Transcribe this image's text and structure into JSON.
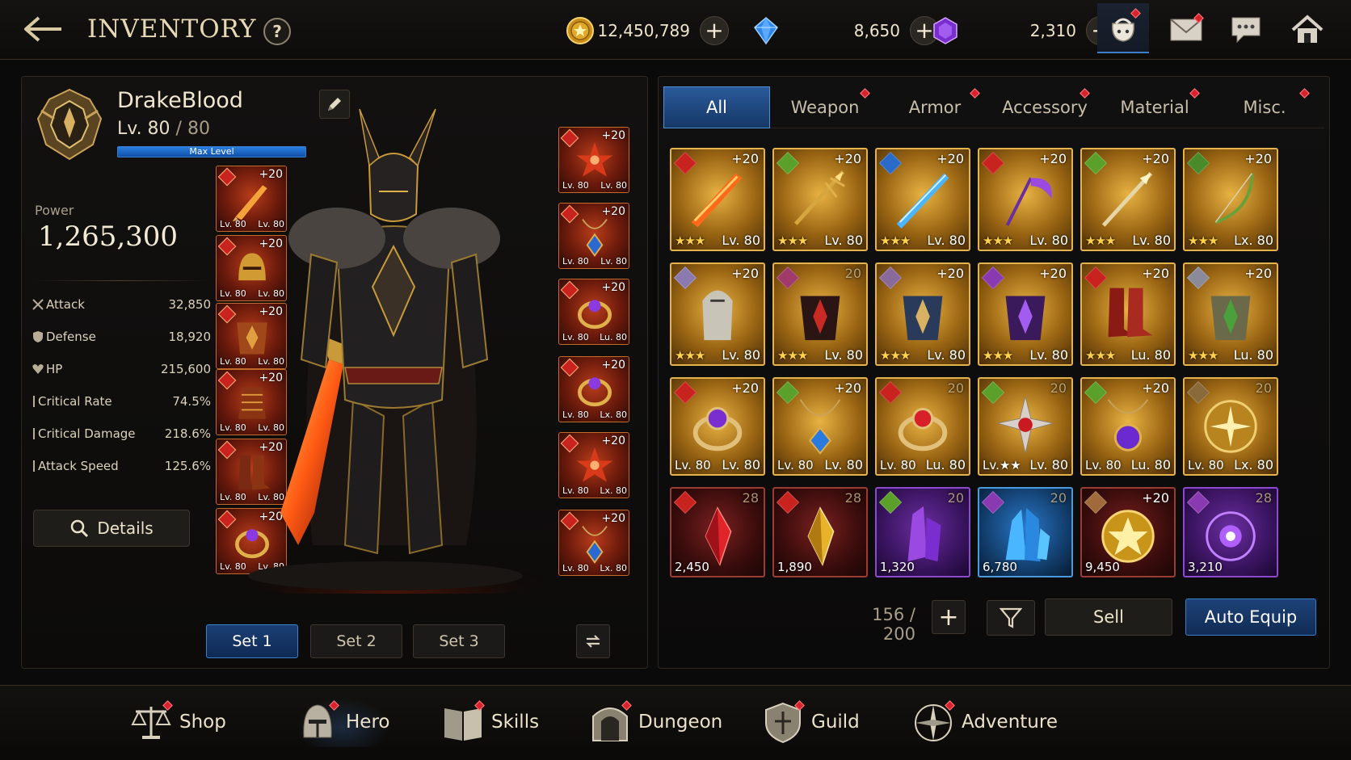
{
  "header": {
    "title": "INVENTORY",
    "help_label": "?",
    "currencies": [
      {
        "name": "gold",
        "value": "12,450,789",
        "icon": "gold-coin-icon",
        "color": "#e0a92a"
      },
      {
        "name": "blue-gem",
        "value": "8,650",
        "icon": "blue-gem-icon",
        "color": "#2f86e8"
      },
      {
        "name": "purple-gem",
        "value": "2,310",
        "icon": "purple-gem-icon",
        "color": "#8a3ee0"
      }
    ],
    "plus_label": "+",
    "icons": [
      "bag-icon",
      "mail-icon",
      "chat-icon",
      "home-icon"
    ]
  },
  "hero": {
    "name": "DrakeBlood",
    "level_prefix": "Lv. 80",
    "level_max": " / 80",
    "max_level_label": "Max Level",
    "power_label": "Power",
    "power_value": "1,265,300",
    "stats": [
      {
        "name": "Attack",
        "value": "32,850",
        "icon": "swords-icon"
      },
      {
        "name": "Defense",
        "value": "18,920",
        "icon": "shield-icon"
      },
      {
        "name": "HP",
        "value": "215,600",
        "icon": "heart-icon"
      },
      {
        "name": "Critical Rate",
        "value": "74.5%",
        "icon": "crit-icon"
      },
      {
        "name": "Critical Damage",
        "value": "218.6%",
        "icon": "crit-icon"
      },
      {
        "name": "Attack Speed",
        "value": "125.6%",
        "icon": "speed-icon"
      }
    ],
    "details_label": "Details",
    "left_slots": [
      {
        "plus": "+20",
        "lv_a": "Lv. 80",
        "lv_b": "Lv. 80",
        "icon": "sword-icon"
      },
      {
        "plus": "+20",
        "lv_a": "Lv. 80",
        "lv_b": "Lv. 80",
        "icon": "helmet-icon"
      },
      {
        "plus": "+20",
        "lv_a": "Lv. 80",
        "lv_b": "Lv. 80",
        "icon": "chest-armor-icon"
      },
      {
        "plus": "+20",
        "lv_a": "Lv. 80",
        "lv_b": "Lv. 80",
        "icon": "gauntlet-icon"
      },
      {
        "plus": "+20",
        "lv_a": "Lv. 80",
        "lv_b": "Lv. 80",
        "icon": "boots-icon"
      },
      {
        "plus": "+20",
        "lv_a": "Lv. 80",
        "lv_b": "Lv. 80",
        "icon": "ring-icon"
      }
    ],
    "right_slots": [
      {
        "plus": "+20",
        "lv_a": "Lv. 80",
        "lv_b": "Lv. 80",
        "icon": "spiked-orb-icon"
      },
      {
        "plus": "+20",
        "lv_a": "Lv. 80",
        "lv_b": "Lv. 80",
        "icon": "amulet-icon"
      },
      {
        "plus": "+20",
        "lv_a": "Lv. 80",
        "lv_b": "Lu. 80",
        "icon": "ring-icon"
      },
      {
        "plus": "+20",
        "lv_a": "Lv. 80",
        "lv_b": "Lx. 80",
        "icon": "ring-icon"
      },
      {
        "plus": "+20",
        "lv_a": "Lv. 80",
        "lv_b": "Lx. 80",
        "icon": "spiked-orb-icon"
      },
      {
        "plus": "+20",
        "lv_a": "Lv. 80",
        "lv_b": "Lx. 80",
        "icon": "amulet-icon"
      }
    ],
    "sets": [
      "Set 1",
      "Set 2",
      "Set 3"
    ],
    "active_set": 0
  },
  "inventory": {
    "tabs": [
      {
        "label": "All",
        "badge": false
      },
      {
        "label": "Weapon",
        "badge": true
      },
      {
        "label": "Armor",
        "badge": true
      },
      {
        "label": "Accessory",
        "badge": true
      },
      {
        "label": "Material",
        "badge": true
      },
      {
        "label": "Misc.",
        "badge": true
      }
    ],
    "active_tab": 0,
    "rows": [
      [
        {
          "frame": "gold",
          "rank_color": "#c9231f",
          "plus": "+20",
          "stars": "★★★",
          "lv": "Lv. 80",
          "icon": "flame-sword-icon"
        },
        {
          "frame": "gold",
          "rank_color": "#5aa02a",
          "plus": "+20",
          "stars": "★★★",
          "lv": "Lv. 80",
          "icon": "golden-spear-icon"
        },
        {
          "frame": "gold",
          "rank_color": "#2a6ac8",
          "plus": "+20",
          "stars": "★★★",
          "lv": "Lv. 80",
          "icon": "ice-sword-icon"
        },
        {
          "frame": "gold",
          "rank_color": "#c9231f",
          "plus": "+20",
          "stars": "★★★",
          "lv": "Lv. 80",
          "icon": "scythe-icon"
        },
        {
          "frame": "gold",
          "rank_color": "#5aa02a",
          "plus": "+20",
          "stars": "★★★",
          "lv": "Lv. 80",
          "icon": "lance-icon"
        },
        {
          "frame": "gold",
          "rank_color": "#4a8a2a",
          "plus": "+20",
          "stars": "★★★",
          "lv": "Lx. 80",
          "icon": "bow-icon"
        }
      ],
      [
        {
          "frame": "gold",
          "rank_color": "#8a7ab0",
          "plus": "+20",
          "stars": "★★★",
          "lv": "Lv. 80",
          "icon": "silver-armor-icon"
        },
        {
          "frame": "gold",
          "rank_color": "#a03a6a",
          "plus": "20",
          "stars": "★★★",
          "lv": "Lv. 80",
          "icon": "crimson-armor-icon"
        },
        {
          "frame": "gold",
          "rank_color": "#8a6a9a",
          "plus": "+20",
          "stars": "★★★",
          "lv": "Lv. 80",
          "icon": "blue-armor-icon"
        },
        {
          "frame": "gold",
          "rank_color": "#8a3ab0",
          "plus": "+20",
          "stars": "★★★",
          "lv": "Lv. 80",
          "icon": "violet-armor-icon"
        },
        {
          "frame": "gold",
          "rank_color": "#c9231f",
          "plus": "+20",
          "stars": "★★★",
          "lv": "Lu. 80",
          "icon": "red-boots-icon"
        },
        {
          "frame": "gold",
          "rank_color": "#8a8a9a",
          "plus": "+20",
          "stars": "★★★",
          "lv": "Lu. 80",
          "icon": "emerald-armor-icon"
        }
      ],
      [
        {
          "frame": "gold",
          "rank_color": "#c9231f",
          "plus": "+20",
          "stars": "Lv. 80",
          "lv": "Lv. 80",
          "icon": "amethyst-ring-icon"
        },
        {
          "frame": "gold",
          "rank_color": "#5aa02a",
          "plus": "+20",
          "stars": "Lv. 80",
          "lv": "Lv. 80",
          "icon": "sapphire-amulet-icon"
        },
        {
          "frame": "gold",
          "rank_color": "#c9231f",
          "plus": "20",
          "stars": "Lv. 80",
          "lv": "Lu. 80",
          "icon": "ruby-ring-icon"
        },
        {
          "frame": "gold",
          "rank_color": "#5aa02a",
          "plus": "20",
          "stars": "Lv.★★",
          "lv": "Lv. 80",
          "icon": "spiked-gem-icon"
        },
        {
          "frame": "gold",
          "rank_color": "#5aa02a",
          "plus": "+20",
          "stars": "Lv. 80",
          "lv": "Lu. 80",
          "icon": "violet-amulet-icon"
        },
        {
          "frame": "gold",
          "rank_color": "#8a6a3a",
          "plus": "20",
          "stars": "Lv. 80",
          "lv": "Lx. 80",
          "icon": "gold-compass-icon"
        }
      ],
      [
        {
          "frame": "red",
          "rank_color": "#c9231f",
          "plus": "28",
          "qty": "2,450",
          "icon": "red-crystal-icon"
        },
        {
          "frame": "red",
          "rank_color": "#c9231f",
          "plus": "28",
          "qty": "1,890",
          "icon": "gold-crystal-icon"
        },
        {
          "frame": "purple",
          "rank_color": "#5aa02a",
          "plus": "20",
          "qty": "1,320",
          "icon": "purple-crystal-icon"
        },
        {
          "frame": "blue",
          "rank_color": "#8a3ab0",
          "plus": "20",
          "qty": "6,780",
          "icon": "blue-crystal-icon"
        },
        {
          "frame": "red",
          "rank_color": "#a06a3a",
          "plus": "+20",
          "qty": "9,450",
          "icon": "gold-emblem-icon"
        },
        {
          "frame": "purple",
          "rank_color": "#8a3ab0",
          "plus": "28",
          "qty": "3,210",
          "icon": "arcane-orb-icon"
        }
      ]
    ],
    "count": "156 / 200",
    "plus_label": "+",
    "sell_label": "Sell",
    "auto_equip_label": "Auto Equip"
  },
  "nav": [
    {
      "label": "Shop",
      "icon": "scales-icon",
      "badge": true
    },
    {
      "label": "Hero",
      "icon": "helmet-icon",
      "badge": true,
      "active": true
    },
    {
      "label": "Skills",
      "icon": "book-icon",
      "badge": true
    },
    {
      "label": "Dungeon",
      "icon": "gate-icon",
      "badge": true
    },
    {
      "label": "Guild",
      "icon": "guild-shield-icon",
      "badge": true
    },
    {
      "label": "Adventure",
      "icon": "compass-icon",
      "badge": true
    }
  ]
}
